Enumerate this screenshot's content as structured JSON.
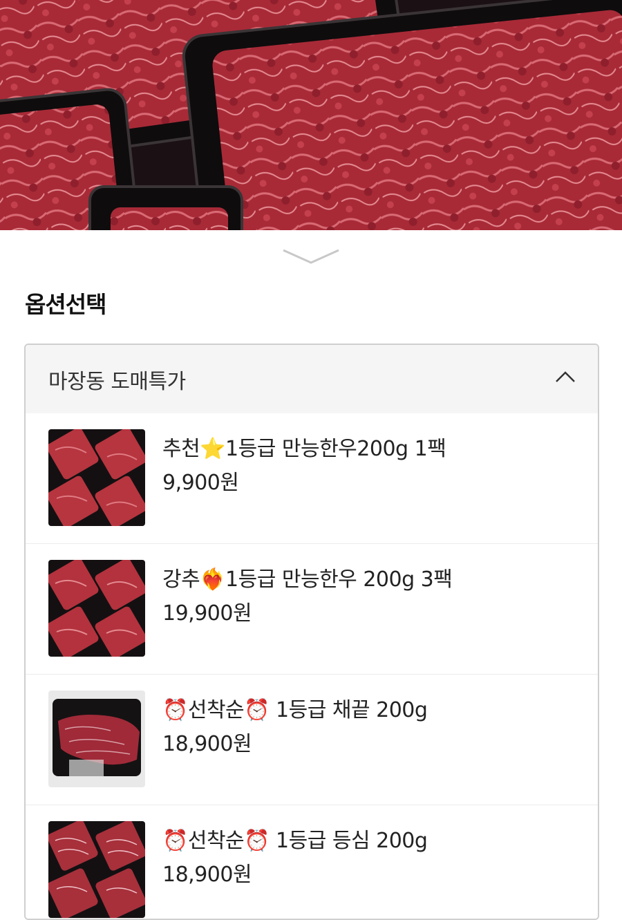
{
  "section_title": "옵션선택",
  "dropdown": {
    "label": "마장동 도매특가",
    "expanded": true
  },
  "options": [
    {
      "name": "추천⭐1등급 만능한우200g 1팩",
      "price": "9,900원"
    },
    {
      "name": "강추❤️‍🔥1등급 만능한우 200g 3팩",
      "price": "19,900원"
    },
    {
      "name": "⏰선착순⏰ 1등급 채끝 200g",
      "price": "18,900원"
    },
    {
      "name": "⏰선착순⏰ 1등급 등심 200g",
      "price": "18,900원"
    }
  ],
  "colors": {
    "meat": "#b0303c",
    "tray": "#141012",
    "header_bg": "#f5f5f5",
    "border": "#cfcfcf"
  }
}
